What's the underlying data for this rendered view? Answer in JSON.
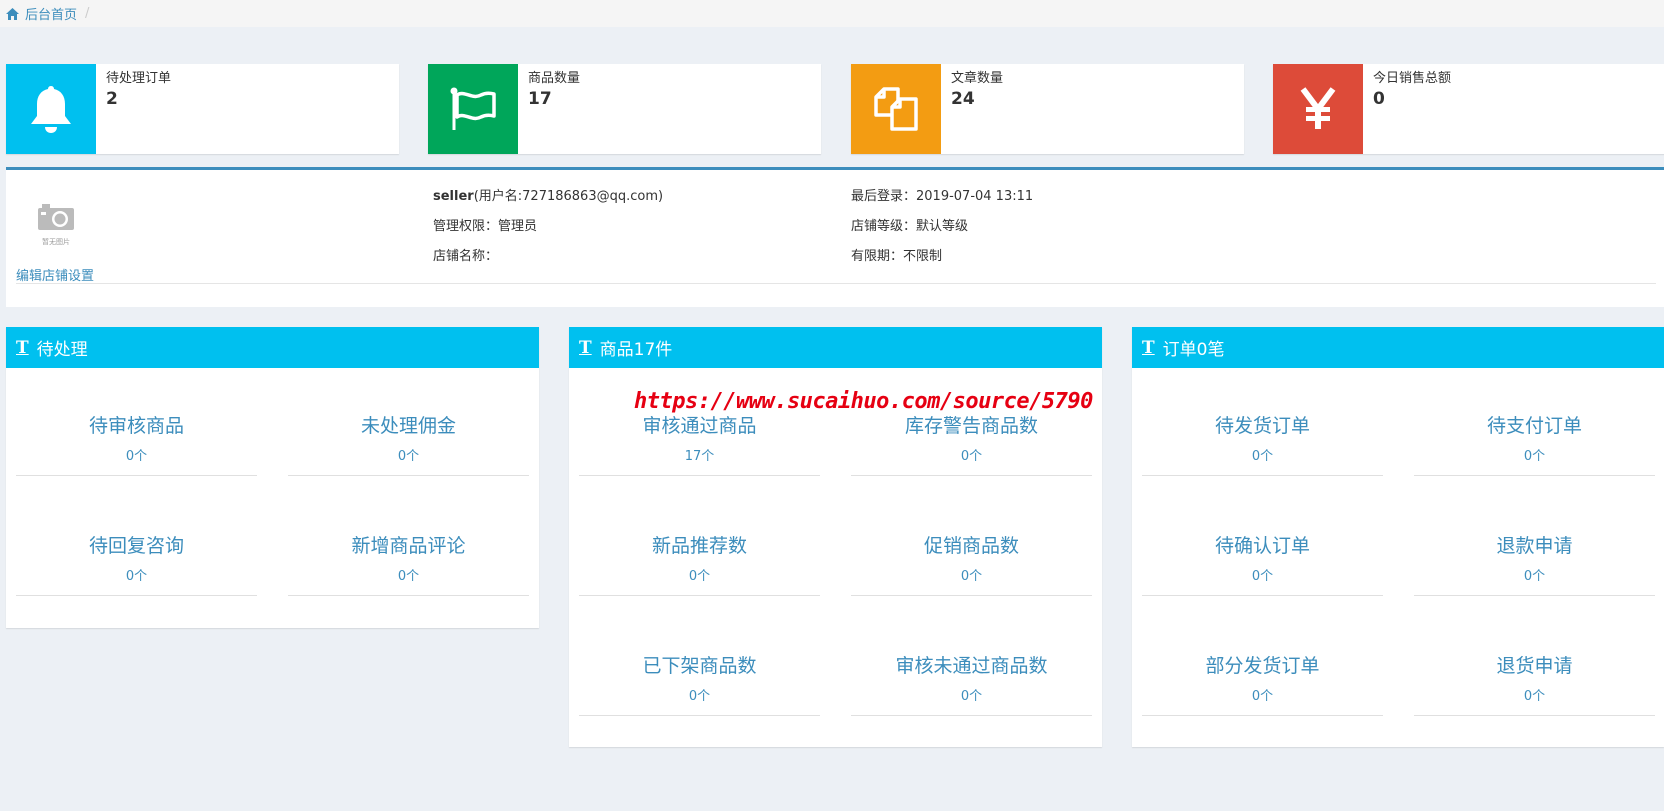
{
  "breadcrumb": {
    "home_label": "后台首页",
    "separator": "/"
  },
  "info_boxes": [
    {
      "label": "待处理订单",
      "value": "2",
      "color": "#00c0ef",
      "icon": "bell-icon"
    },
    {
      "label": "商品数量",
      "value": "17",
      "color": "#00a65a",
      "icon": "flag-icon"
    },
    {
      "label": "文章数量",
      "value": "24",
      "color": "#f39c12",
      "icon": "files-icon"
    },
    {
      "label": "今日销售总额",
      "value": "0",
      "color": "#dd4b39",
      "icon": "yen-icon"
    }
  ],
  "profile": {
    "photo_caption": "暂无图片",
    "edit_link": "编辑店铺设置",
    "username_strong": "seller",
    "username_rest": "(用户名:727186863@qq.com)",
    "permission": "管理权限：管理员",
    "shop_name": "店铺名称：",
    "last_login": "最后登录：2019-07-04 13:11",
    "shop_level": "店铺等级：默认等级",
    "validity": "有限期：不限制"
  },
  "panels": [
    {
      "title": "待处理",
      "items": [
        {
          "title": "待审核商品",
          "count": "0个"
        },
        {
          "title": "未处理佣金",
          "count": "0个"
        },
        {
          "title": "待回复咨询",
          "count": "0个"
        },
        {
          "title": "新增商品评论",
          "count": "0个"
        }
      ]
    },
    {
      "title": "商品17件",
      "items": [
        {
          "title": "审核通过商品",
          "count": "17个"
        },
        {
          "title": "库存警告商品数",
          "count": "0个"
        },
        {
          "title": "新品推荐数",
          "count": "0个"
        },
        {
          "title": "促销商品数",
          "count": "0个"
        },
        {
          "title": "已下架商品数",
          "count": "0个"
        },
        {
          "title": "审核未通过商品数",
          "count": "0个"
        }
      ]
    },
    {
      "title": "订单0笔",
      "items": [
        {
          "title": "待发货订单",
          "count": "0个"
        },
        {
          "title": "待支付订单",
          "count": "0个"
        },
        {
          "title": "待确认订单",
          "count": "0个"
        },
        {
          "title": "退款申请",
          "count": "0个"
        },
        {
          "title": "部分发货订单",
          "count": "0个"
        },
        {
          "title": "退货申请",
          "count": "0个"
        }
      ]
    }
  ],
  "watermark": "https://www.sucaihuo.com/source/5790"
}
